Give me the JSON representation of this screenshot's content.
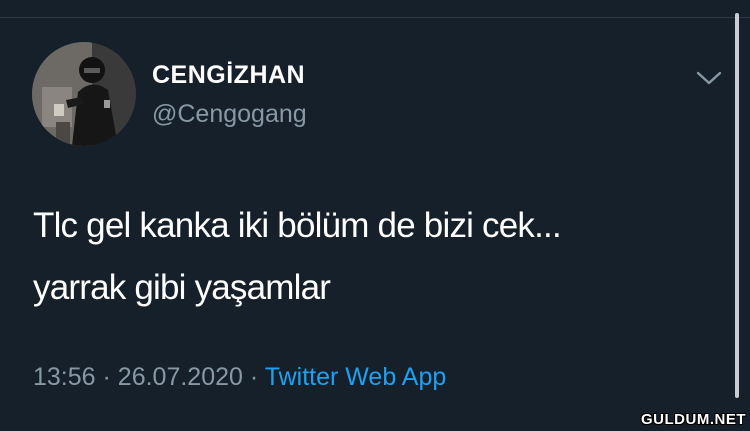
{
  "tweet": {
    "author": {
      "display_name": "CENGİZHAN",
      "handle": "@Cengogang"
    },
    "text_lines": [
      "Tlc gel kanka iki bölüm de bizi cek...",
      "yarrak gibi yaşamlar"
    ],
    "time": "13:56",
    "date": "26.07.2020",
    "separator": "·",
    "source": "Twitter Web App"
  },
  "icons": {
    "menu": "chevron-down-icon",
    "avatar": "avatar"
  },
  "colors": {
    "background": "#15202b",
    "text": "#ffffff",
    "secondary": "#8899a6",
    "link": "#1da1f2"
  },
  "watermark": "GULDUM.NET"
}
